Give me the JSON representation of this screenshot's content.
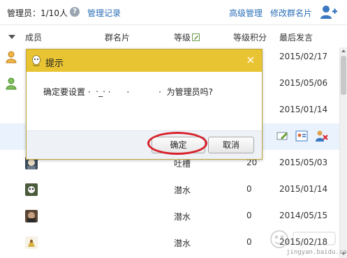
{
  "header": {
    "admin_count": "管理员：1/10人",
    "help_glyph": "?",
    "manage_log": "管理记录",
    "advanced_manage": "高级管理",
    "edit_group_card": "修改群名片"
  },
  "table": {
    "columns": [
      "成员",
      "群名片",
      "等级",
      "等级积分",
      "最后发言"
    ],
    "rows": [
      {
        "card": "",
        "level": "",
        "score": "",
        "date": "2015/02/17"
      },
      {
        "card": "",
        "level": "",
        "score": "",
        "date": "2015/05/06"
      },
      {
        "card": "",
        "level": "",
        "score": "",
        "date": "2015/01/14"
      },
      {
        "card": "",
        "level": "",
        "score": "",
        "date": ""
      },
      {
        "card": "",
        "level": "吐槽",
        "score": "20",
        "date": "2015/05/03"
      },
      {
        "card": "",
        "level": "潜水",
        "score": "0",
        "date": "2015/01/14"
      },
      {
        "card": "",
        "level": "潜水",
        "score": "0",
        "date": "2014/05/15"
      },
      {
        "card": "",
        "level": "潜水",
        "score": "0",
        "date": "2015/02/18"
      }
    ]
  },
  "dialog": {
    "title": "提示",
    "close_glyph": "×",
    "message": "确定要设置 ·  ‧_‧ ·      ·           ·  为管理员吗?",
    "ok_label": "确定",
    "cancel_label": "取消"
  },
  "watermark": {
    "text": "jingyan.baidu.com"
  },
  "colors": {
    "link": "#2a6fb8",
    "dialog_header": "#e8c332",
    "highlight_ring": "#d9202a",
    "selected_row": "#eaf3fd"
  },
  "icons": {
    "help": "question-circle-icon",
    "add_user": "add-user-icon",
    "sort": "sort-down-arrow-icon",
    "edit": "pencil-edit-icon",
    "close": "close-icon",
    "qq": "qq-penguin-icon",
    "admin": "admin-person-icon"
  }
}
